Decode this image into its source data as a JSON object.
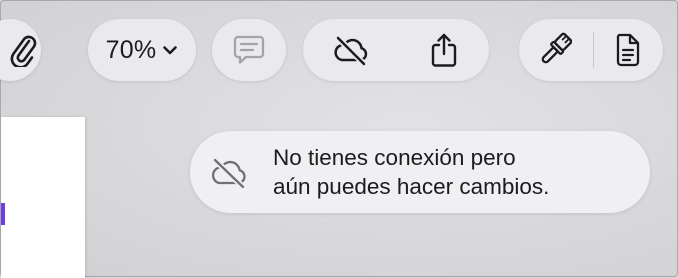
{
  "toolbar": {
    "zoom_label": "70%",
    "icons": [
      "paperclip-icon",
      "chevron-down-icon",
      "comment-icon",
      "cloud-offline-icon",
      "share-icon",
      "paintbrush-icon",
      "document-icon"
    ],
    "icon_color": "#1c1c1e",
    "disabled_icon_color": "#a4a4a8",
    "button_background": "#eaeaed"
  },
  "toast": {
    "line1": "No tienes conexión pero",
    "line2": "aún puedes hacer cambios.",
    "icon": "cloud-offline-icon",
    "icon_color": "#6f6f74"
  },
  "document": {
    "accent_color": "#6e3fe0"
  }
}
